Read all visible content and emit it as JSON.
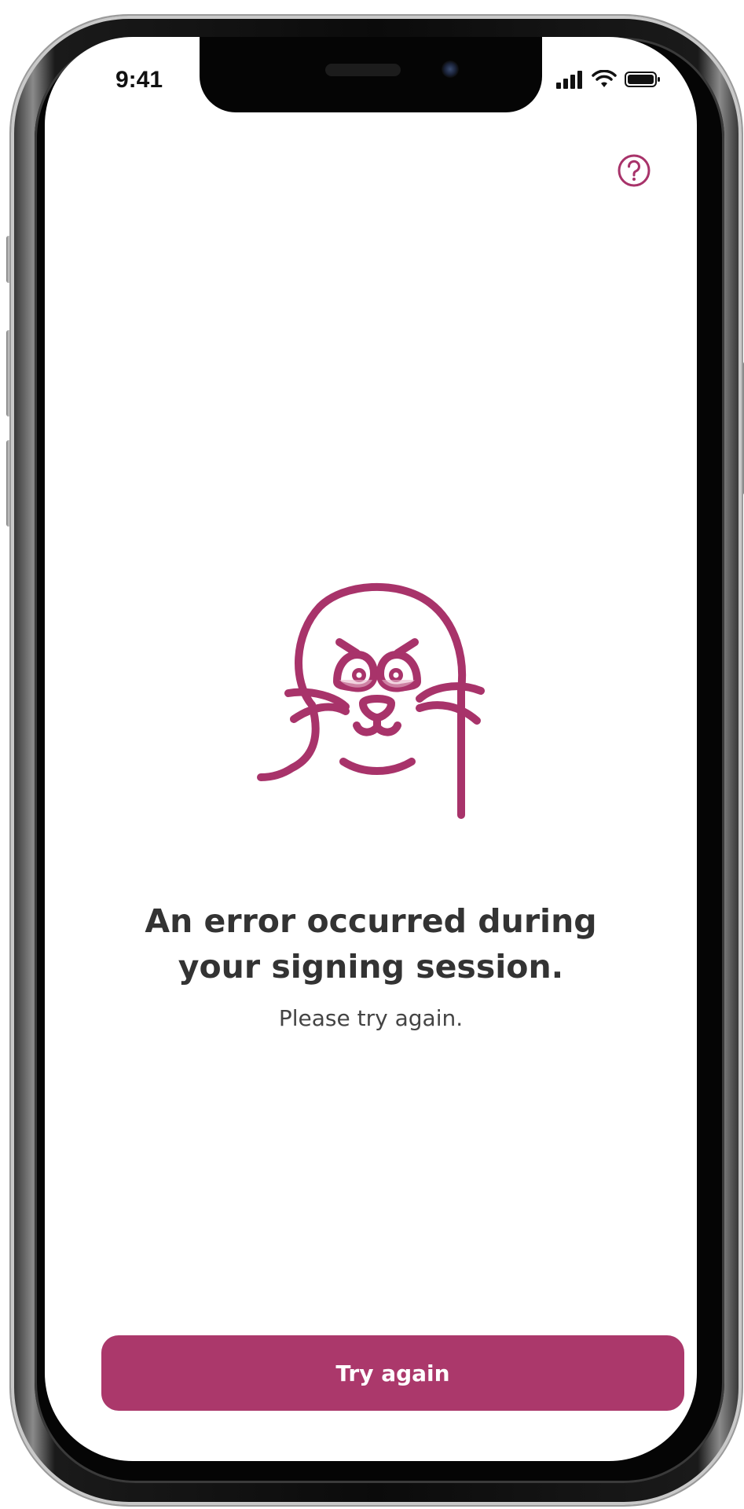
{
  "status_bar": {
    "time": "9:41",
    "icons": [
      "cellular-signal-icon",
      "wifi-icon",
      "battery-icon"
    ]
  },
  "header": {
    "help_icon": "question-mark-circle-icon"
  },
  "illustration": {
    "name": "sad-seal-icon",
    "color": "#a8336a"
  },
  "message": {
    "title_line1": "An error occurred during",
    "title_line2": "your signing session.",
    "subtitle": "Please try again."
  },
  "actions": {
    "primary_label": "Try again",
    "primary_color": "#ab386b"
  }
}
